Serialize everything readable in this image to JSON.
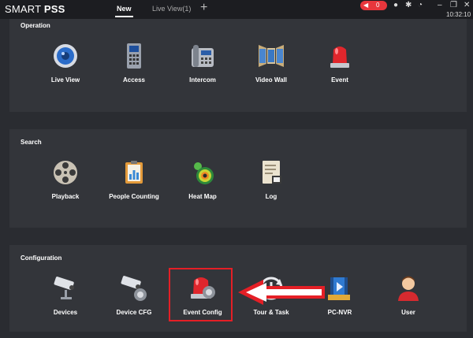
{
  "app": {
    "title_light": "SMART",
    "title_bold": "PSS"
  },
  "tabs": [
    {
      "label": "New"
    },
    {
      "label": "Live View(1)"
    }
  ],
  "alarm": {
    "count": "0"
  },
  "clock": "10:32:10",
  "sections": {
    "operation": {
      "title": "Operation",
      "items": [
        {
          "label": "Live View",
          "icon": "live-view-icon"
        },
        {
          "label": "Access",
          "icon": "access-icon"
        },
        {
          "label": "Intercom",
          "icon": "intercom-icon"
        },
        {
          "label": "Video Wall",
          "icon": "video-wall-icon"
        },
        {
          "label": "Event",
          "icon": "event-icon"
        }
      ]
    },
    "search": {
      "title": "Search",
      "items": [
        {
          "label": "Playback",
          "icon": "playback-icon"
        },
        {
          "label": "People Counting",
          "icon": "people-counting-icon"
        },
        {
          "label": "Heat Map",
          "icon": "heat-map-icon"
        },
        {
          "label": "Log",
          "icon": "log-icon"
        }
      ]
    },
    "configuration": {
      "title": "Configuration",
      "items": [
        {
          "label": "Devices",
          "icon": "devices-icon"
        },
        {
          "label": "Device CFG",
          "icon": "device-cfg-icon"
        },
        {
          "label": "Event Config",
          "icon": "event-config-icon"
        },
        {
          "label": "Tour & Task",
          "icon": "tour-task-icon"
        },
        {
          "label": "PC-NVR",
          "icon": "pc-nvr-icon"
        },
        {
          "label": "User",
          "icon": "user-icon"
        }
      ]
    }
  },
  "colors": {
    "accent_red": "#e41f26",
    "background": "#2a2c31",
    "panel": "#33353a"
  }
}
